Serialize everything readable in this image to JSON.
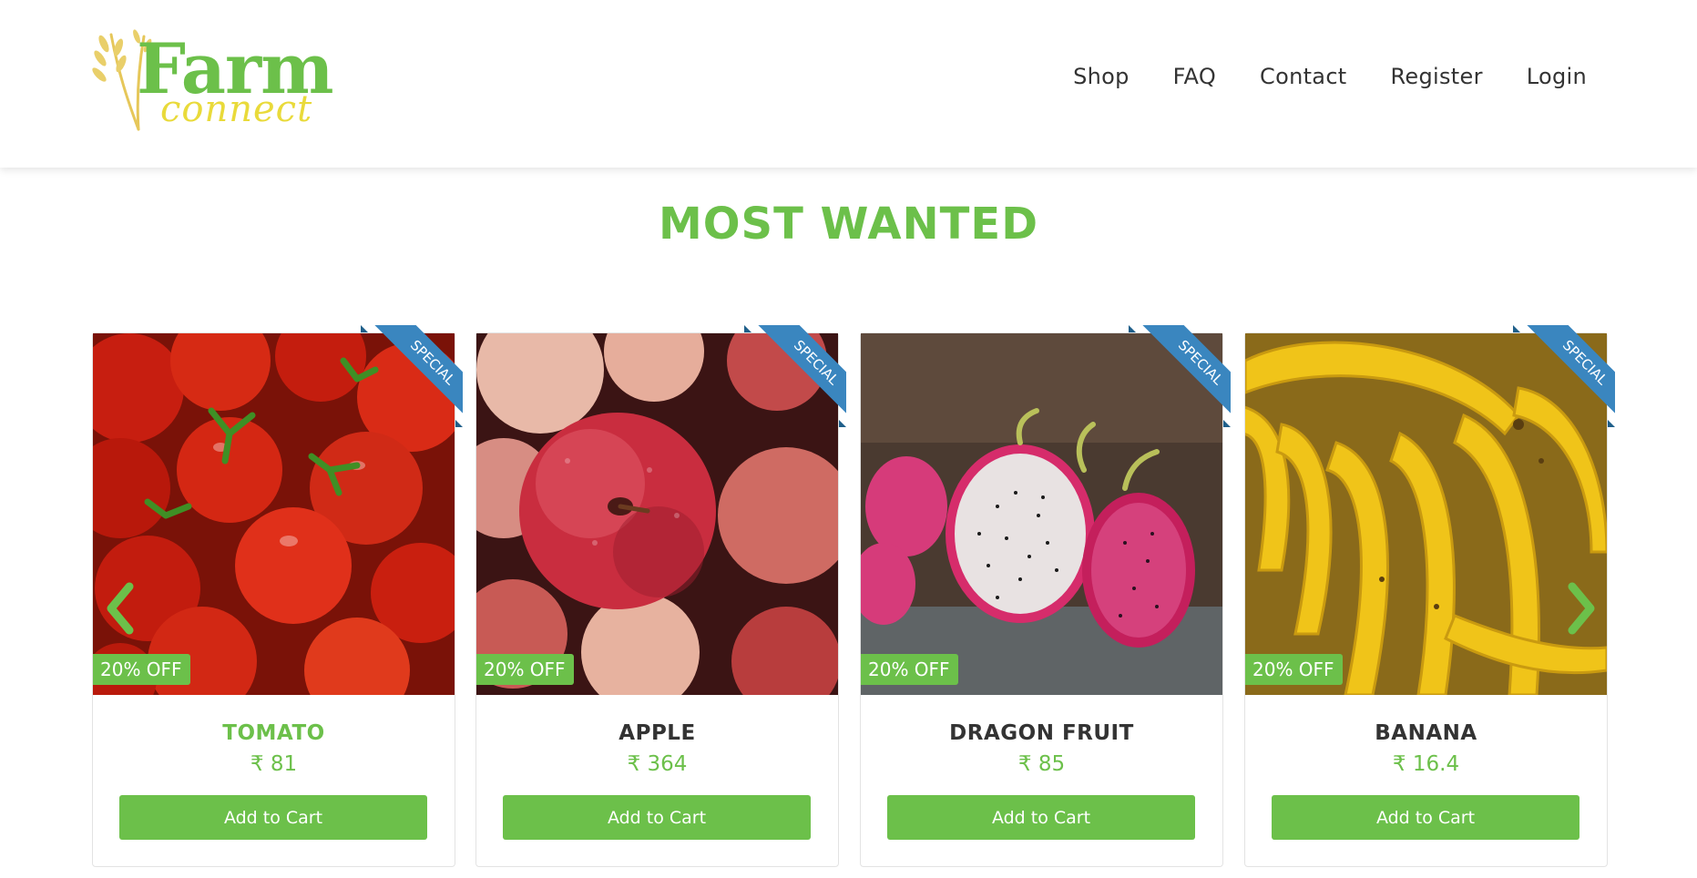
{
  "header": {
    "logo_text": "Farm",
    "logo_subtext": "connect",
    "nav": [
      {
        "label": "Shop"
      },
      {
        "label": "FAQ"
      },
      {
        "label": "Contact"
      },
      {
        "label": "Register"
      },
      {
        "label": "Login"
      }
    ]
  },
  "section": {
    "title": "MOST WANTED"
  },
  "products": [
    {
      "name": "TOMATO",
      "price": "₹ 81",
      "discount": "20% OFF",
      "ribbon": "SPECIAL",
      "button": "Add to Cart",
      "image_icon": "tomato-image"
    },
    {
      "name": "APPLE",
      "price": "₹ 364",
      "discount": "20% OFF",
      "ribbon": "SPECIAL",
      "button": "Add to Cart",
      "image_icon": "apple-image"
    },
    {
      "name": "DRAGON FRUIT",
      "price": "₹ 85",
      "discount": "20% OFF",
      "ribbon": "SPECIAL",
      "button": "Add to Cart",
      "image_icon": "dragon-fruit-image"
    },
    {
      "name": "BANANA",
      "price": "₹ 16.4",
      "discount": "20% OFF",
      "ribbon": "SPECIAL",
      "button": "Add to Cart",
      "image_icon": "banana-image"
    }
  ],
  "carousel": {
    "prev_icon": "chevron-left-icon",
    "next_icon": "chevron-right-icon"
  },
  "colors": {
    "accent": "#6cc04a",
    "ribbon": "#3a86bf",
    "text": "#333333",
    "logo_sub": "#e9da3a"
  }
}
